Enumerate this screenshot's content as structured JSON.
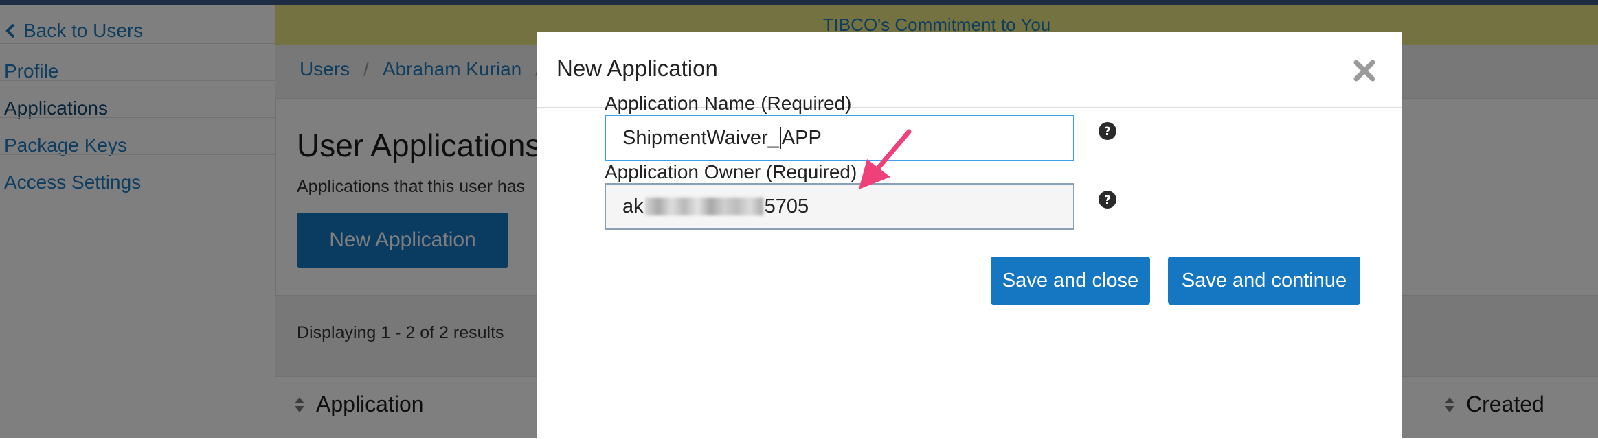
{
  "sidebar": {
    "back_label": "Back to Users",
    "items": [
      {
        "label": "Profile"
      },
      {
        "label": "Applications"
      },
      {
        "label": "Package Keys"
      },
      {
        "label": "Access Settings"
      }
    ]
  },
  "banner": {
    "text": "TIBCO's Commitment to You"
  },
  "breadcrumb": [
    "Users",
    "Abraham Kurian"
  ],
  "page": {
    "title": "User Applications",
    "description": "Applications that this user has",
    "new_app_button": "New Application",
    "results_text": "Displaying 1 - 2 of 2 results",
    "columns": [
      "Application",
      "Created"
    ]
  },
  "modal": {
    "title": "New Application",
    "name_label": "Application Name (Required)",
    "name_value_before_caret": "ShipmentWaiver_",
    "name_value_after_caret": "APP",
    "owner_label": "Application Owner (Required)",
    "owner_value_prefix": "ak",
    "owner_value_suffix": "5705",
    "save_close_label": "Save and close",
    "save_continue_label": "Save and continue"
  },
  "colors": {
    "accent": "#1576c2",
    "link": "#1f7ac0",
    "banner_bg": "#e6e480",
    "annotation_arrow": "#f0407a"
  }
}
